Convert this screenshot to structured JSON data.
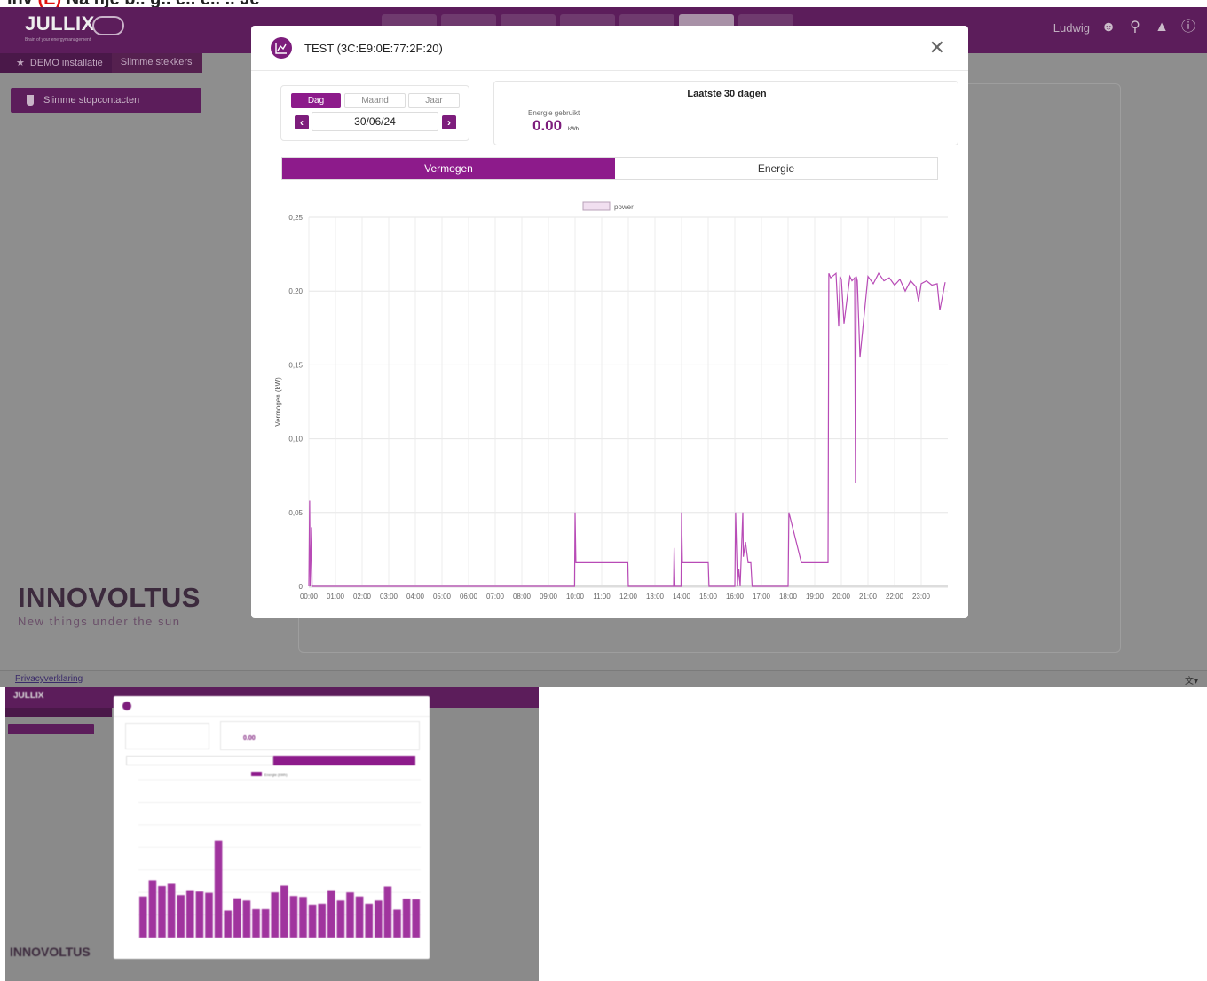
{
  "app": {
    "logo": "JULLIX",
    "logo_tagline": "Brain of your energymanagement",
    "user_name": "Ludwig",
    "breadcrumbs": [
      "DEMO installatie",
      "Slimme stekkers"
    ],
    "sidebar_items": [
      "Slimme stopcontacten"
    ],
    "brand": "INNOVOLTUS",
    "brand_tagline": "New things under the sun",
    "footer_link": "Privacyverklaring",
    "icons": [
      "user-icon",
      "search-icon",
      "bell-icon",
      "help-icon",
      "star-icon",
      "plug-icon",
      "translate-icon"
    ]
  },
  "modal": {
    "title": "TEST (3C:E9:0E:77:2F:20)",
    "period_options": [
      "Dag",
      "Maand",
      "Jaar"
    ],
    "selected_period": "Dag",
    "date": "30/06/24",
    "summary_title": "Laatste 30 dagen",
    "summary_label": "Energie gebruikt",
    "summary_value": "0.00",
    "summary_unit": "kWh",
    "tabs": [
      "Vermogen",
      "Energie"
    ],
    "active_tab": "Vermogen"
  },
  "colors": {
    "accent": "#8d1b8b",
    "header": "#5c1d5b",
    "line": "#b84bb6"
  },
  "chart_data": [
    {
      "type": "line",
      "legend": [
        "power"
      ],
      "ylabel": "Vermogen (kW)",
      "xlabel": "",
      "ylim": [
        0,
        0.25
      ],
      "ytick_labels": [
        "0",
        "0,05",
        "0,10",
        "0,15",
        "0,20",
        "0,25"
      ],
      "xtick_labels": [
        "00:00",
        "01:00",
        "02:00",
        "03:00",
        "04:00",
        "05:00",
        "06:00",
        "07:00",
        "08:00",
        "09:00",
        "10:00",
        "11:00",
        "12:00",
        "13:00",
        "14:00",
        "15:00",
        "16:00",
        "17:00",
        "18:00",
        "19:00",
        "20:00",
        "21:00",
        "22:00",
        "23:00"
      ],
      "series": [
        {
          "name": "power",
          "x_hours": [
            0.0,
            0.03,
            0.05,
            0.1,
            0.12,
            0.15,
            0.2,
            9.98,
            10.0,
            10.03,
            11.0,
            11.3,
            11.98,
            12.0,
            12.5,
            13.7,
            13.72,
            13.75,
            13.8,
            13.98,
            14.0,
            14.03,
            15.0,
            15.03,
            16.0,
            16.03,
            16.1,
            16.15,
            16.2,
            16.3,
            16.32,
            16.4,
            16.5,
            16.6,
            16.65,
            17.5,
            18.0,
            18.03,
            18.5,
            19.5,
            19.53,
            19.6,
            19.8,
            19.9,
            19.95,
            20.0,
            20.1,
            20.3,
            20.32,
            20.4,
            20.5,
            20.53,
            20.56,
            20.6,
            20.7,
            21.0,
            21.2,
            21.4,
            21.6,
            21.8,
            22.0,
            22.2,
            22.4,
            22.6,
            22.8,
            22.9,
            23.0,
            23.2,
            23.4,
            23.6,
            23.7,
            23.9
          ],
          "y": [
            0.0,
            0.058,
            0.0,
            0.04,
            0.0,
            0.0,
            0.0,
            0.0,
            0.05,
            0.016,
            0.016,
            0.016,
            0.016,
            0.0,
            0.0,
            0.0,
            0.026,
            0.0,
            0.0,
            0.0,
            0.05,
            0.016,
            0.016,
            0.0,
            0.0,
            0.05,
            0.0,
            0.012,
            0.0,
            0.05,
            0.02,
            0.03,
            0.016,
            0.016,
            0.0,
            0.0,
            0.0,
            0.05,
            0.016,
            0.016,
            0.212,
            0.209,
            0.212,
            0.176,
            0.21,
            0.208,
            0.178,
            0.207,
            0.21,
            0.207,
            0.209,
            0.07,
            0.21,
            0.207,
            0.155,
            0.21,
            0.205,
            0.212,
            0.207,
            0.209,
            0.204,
            0.208,
            0.2,
            0.207,
            0.203,
            0.193,
            0.205,
            0.207,
            0.204,
            0.205,
            0.187,
            0.206
          ]
        }
      ]
    },
    {
      "type": "bar",
      "legend": [
        "Energie (kWh)"
      ],
      "ylabel": "Energie (kWh)",
      "ylim": [
        0,
        3.5
      ],
      "series": [
        {
          "name": "Energie",
          "values": [
            0.91,
            1.27,
            1.14,
            1.19,
            0.94,
            1.05,
            1.02,
            0.99,
            2.15,
            0.6,
            0.87,
            0.82,
            0.63,
            0.63,
            1.0,
            1.15,
            0.92,
            0.9,
            0.73,
            0.75,
            1.05,
            0.82,
            1.0,
            0.91,
            0.75,
            0.82,
            1.13,
            0.62,
            0.86,
            0.85
          ]
        }
      ]
    }
  ]
}
